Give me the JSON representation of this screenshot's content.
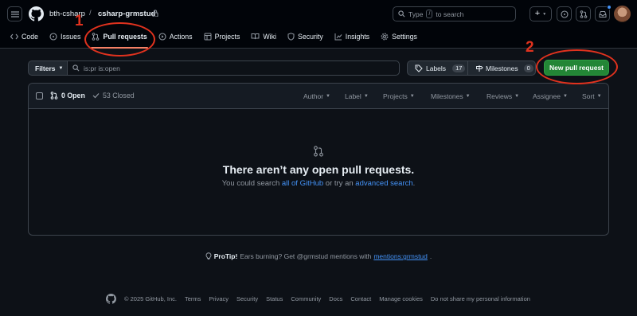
{
  "header": {
    "owner": "bth-csharp",
    "separator": "/",
    "repo": "csharp-grmstud",
    "search_placeholder_pre": "Type",
    "search_key": "/",
    "search_placeholder_post": "to search",
    "plus_label": "+"
  },
  "tabs": [
    {
      "label": "Code"
    },
    {
      "label": "Issues"
    },
    {
      "label": "Pull requests"
    },
    {
      "label": "Actions"
    },
    {
      "label": "Projects"
    },
    {
      "label": "Wiki"
    },
    {
      "label": "Security"
    },
    {
      "label": "Insights"
    },
    {
      "label": "Settings"
    }
  ],
  "toolbar": {
    "filters_label": "Filters",
    "search_value": "is:pr is:open",
    "labels_label": "Labels",
    "labels_count": "17",
    "milestones_label": "Milestones",
    "milestones_count": "0",
    "new_pr_label": "New pull request"
  },
  "list": {
    "open_label": "0 Open",
    "closed_label": "53 Closed",
    "filters": [
      "Author",
      "Label",
      "Projects",
      "Milestones",
      "Reviews",
      "Assignee",
      "Sort"
    ]
  },
  "empty": {
    "title": "There aren’t any open pull requests.",
    "text_pre": "You could search",
    "link1": "all of GitHub",
    "text_mid": "or try an",
    "link2": "advanced search",
    "text_post": "."
  },
  "protip": {
    "strong": "ProTip!",
    "text": "Ears burning? Get @grmstud mentions with",
    "link": "mentions:grmstud",
    "end": "."
  },
  "footer": {
    "copyright": "© 2025 GitHub, Inc.",
    "links": [
      "Terms",
      "Privacy",
      "Security",
      "Status",
      "Community",
      "Docs",
      "Contact",
      "Manage cookies",
      "Do not share my personal information"
    ]
  },
  "annotations": {
    "one": "1",
    "two": "2",
    "color": "#e0321e"
  },
  "colors": {
    "background": "#0d1117",
    "topbar": "#010409",
    "accent_green": "#238636",
    "link": "#4493f8",
    "tab_underline": "#f78166"
  },
  "icons": {
    "menu": "hamburger-icon",
    "logo": "github-mark-icon",
    "lock": "lock-icon"
  }
}
